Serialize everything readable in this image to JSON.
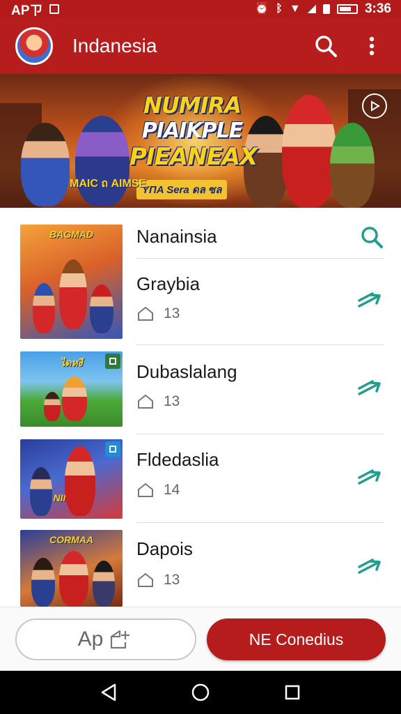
{
  "status_bar": {
    "left_text": "APㄗ",
    "right_text": "3:36"
  },
  "app_bar": {
    "title": "Indanesia"
  },
  "banner": {
    "line1": "NUMIRA",
    "line2": "PIAIKPLE",
    "line3": "PIEANEAX",
    "subtitle": "ΥΠΑ Sera ดล ซล",
    "badge": "MAIC ถ AIMSE"
  },
  "list": {
    "items": [
      {
        "title": "Nanainsia",
        "count": "",
        "thumb_label": "BAGMAD",
        "action_icon": "search-icon"
      },
      {
        "title": "Graybia",
        "count": "13",
        "thumb_label": "",
        "action_icon": "forward-arrows-icon"
      },
      {
        "title": "Dubaslalang",
        "count": "13",
        "thumb_label": "ไดหงี",
        "action_icon": "forward-arrows-icon"
      },
      {
        "title": "Fldedaslia",
        "count": "14",
        "thumb_label": "NINIRIN",
        "action_icon": "forward-arrows-icon"
      },
      {
        "title": "Dapois",
        "count": "13",
        "thumb_label": "CORMAA",
        "action_icon": "forward-arrows-icon"
      }
    ]
  },
  "bottom": {
    "secondary_label": "Ap",
    "primary_label": "NE Conedius"
  },
  "colors": {
    "brand_red": "#b81d1d",
    "accent_teal": "#1f9e8e"
  }
}
